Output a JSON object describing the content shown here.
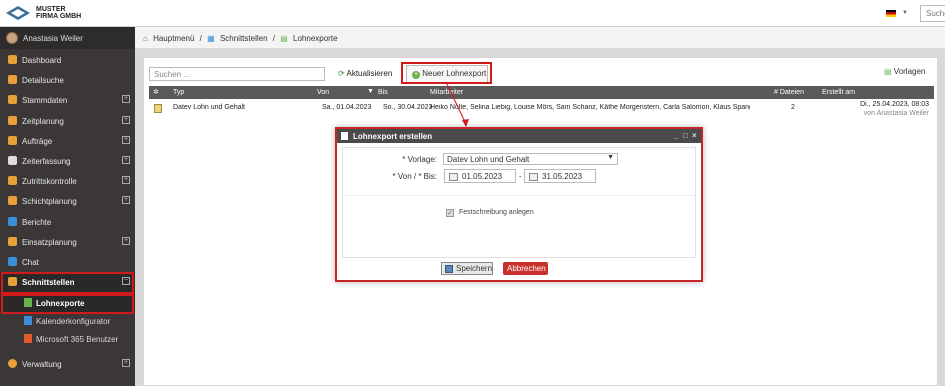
{
  "header": {
    "company_line1": "MUSTER",
    "company_line2": "FIRMA GMBH",
    "search_placeholder": "Suche"
  },
  "sidebar": {
    "user_name": "Anastasia Weiler",
    "items": [
      {
        "label": "Dashboard",
        "icon": "home-icon",
        "color": "#e8a03a",
        "expandable": false
      },
      {
        "label": "Detailsuche",
        "icon": "search-icon",
        "color": "#e8a03a",
        "expandable": false
      },
      {
        "label": "Stammdaten",
        "icon": "database-icon",
        "color": "#e8a03a",
        "expandable": true
      },
      {
        "label": "Zeitplanung",
        "icon": "calendar-icon",
        "color": "#e8a03a",
        "expandable": true
      },
      {
        "label": "Aufträge",
        "icon": "briefcase-icon",
        "color": "#e8a03a",
        "expandable": true
      },
      {
        "label": "Zeiterfassung",
        "icon": "clock-icon",
        "color": "#dddddd",
        "expandable": true
      },
      {
        "label": "Zutrittskontrolle",
        "icon": "door-icon",
        "color": "#e8a03a",
        "expandable": true
      },
      {
        "label": "Schichtplanung",
        "icon": "shift-icon",
        "color": "#e8a03a",
        "expandable": true
      },
      {
        "label": "Berichte",
        "icon": "report-icon",
        "color": "#3a8ed8",
        "expandable": false
      },
      {
        "label": "Einsatzplanung",
        "icon": "deploy-icon",
        "color": "#e8a03a",
        "expandable": true
      },
      {
        "label": "Chat",
        "icon": "chat-icon",
        "color": "#3a8ed8",
        "expandable": false
      },
      {
        "label": "Schnittstellen",
        "icon": "interface-icon",
        "color": "#e8a03a",
        "expandable": true,
        "expanded": true
      }
    ],
    "subitems": [
      {
        "label": "Lohnexporte",
        "icon": "document-icon",
        "color": "#6ab04c",
        "current": true
      },
      {
        "label": "Kalenderkonfigurator",
        "icon": "calendar-config-icon",
        "color": "#3a8ed8"
      },
      {
        "label": "Microsoft 365 Benutzer",
        "icon": "office-icon",
        "color": "#e55a2b"
      }
    ],
    "bottom_item": {
      "label": "Verwaltung",
      "icon": "gear-icon",
      "color": "#e8a03a"
    }
  },
  "breadcrumb": [
    "Hauptmenü",
    "/",
    "Schnittstellen",
    "/",
    "Lohnexporte"
  ],
  "toolbar": {
    "search_placeholder": "Suchen ...",
    "refresh_label": "Aktualisieren",
    "new_label": "Neuer Lohnexport",
    "templates_label": "Vorlagen"
  },
  "table": {
    "columns": [
      "Typ",
      "Von",
      "Bis",
      "Mitarbeiter",
      "# Dateien",
      "Erstellt am"
    ],
    "rows": [
      {
        "typ": "Datev Lohn und Gehalt",
        "von": "Sa., 01.04.2023",
        "bis": "So., 30.04.2023",
        "mitarbeiter": "Heiko Nolte, Selina Liebig, Louise Mörs, Sam Schanz, Käthe Morgenstern, Carla Salomon, Klaus Spang, Finja",
        "dateien": "2",
        "erstellt": "Di., 25.04.2023, 08:03",
        "erstellt_von": "von Anastasia Weiler"
      }
    ]
  },
  "dialog": {
    "title": "Lohnexport erstellen",
    "vorlage_label": "* Vorlage:",
    "vorlage_value": "Datev Lohn und Gehalt",
    "von_bis_label": "* Von / * Bis:",
    "von_value": "01.05.2023",
    "separator": "-",
    "bis_value": "31.05.2023",
    "checkbox_label": "Festschreibung anlegen",
    "save_label": "Speichern",
    "cancel_label": "Abbrechen"
  },
  "colors": {
    "highlight": "#d11a1a",
    "sidebar_bg": "#3a3736",
    "cancel_bg": "#c9302c"
  }
}
